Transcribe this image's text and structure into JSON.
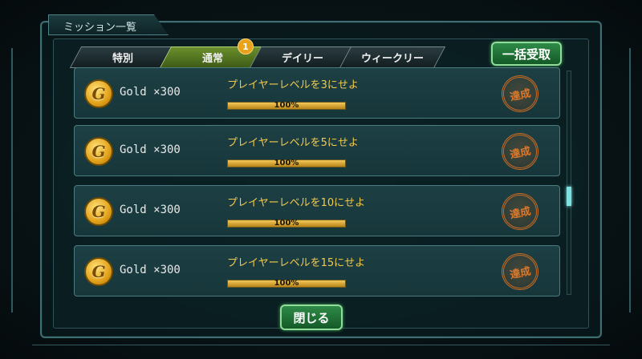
{
  "window": {
    "title": "ミッション一覧"
  },
  "tabs": [
    {
      "label": "特別",
      "active": false
    },
    {
      "label": "通常",
      "active": true
    },
    {
      "label": "デイリー",
      "active": false
    },
    {
      "label": "ウィークリー",
      "active": false
    }
  ],
  "badge": {
    "count": "1"
  },
  "collect_all_label": "一括受取",
  "close_label": "閉じる",
  "missions": [
    {
      "reward": "Gold ×300",
      "description": "プレイヤーレベルを3にせよ",
      "progress_text": "100%",
      "progress": 1.0,
      "status": "達成",
      "icon": "gold-coin-icon"
    },
    {
      "reward": "Gold ×300",
      "description": "プレイヤーレベルを5にせよ",
      "progress_text": "100%",
      "progress": 1.0,
      "status": "達成",
      "icon": "gold-coin-icon"
    },
    {
      "reward": "Gold ×300",
      "description": "プレイヤーレベルを10にせよ",
      "progress_text": "100%",
      "progress": 1.0,
      "status": "達成",
      "icon": "gold-coin-icon"
    },
    {
      "reward": "Gold ×300",
      "description": "プレイヤーレベルを15にせよ",
      "progress_text": "100%",
      "progress": 1.0,
      "status": "達成",
      "icon": "gold-coin-icon"
    }
  ],
  "colors": {
    "accent_green": "#2e8a47",
    "mission_text": "#f2c94c",
    "stamp": "#c46a25"
  }
}
